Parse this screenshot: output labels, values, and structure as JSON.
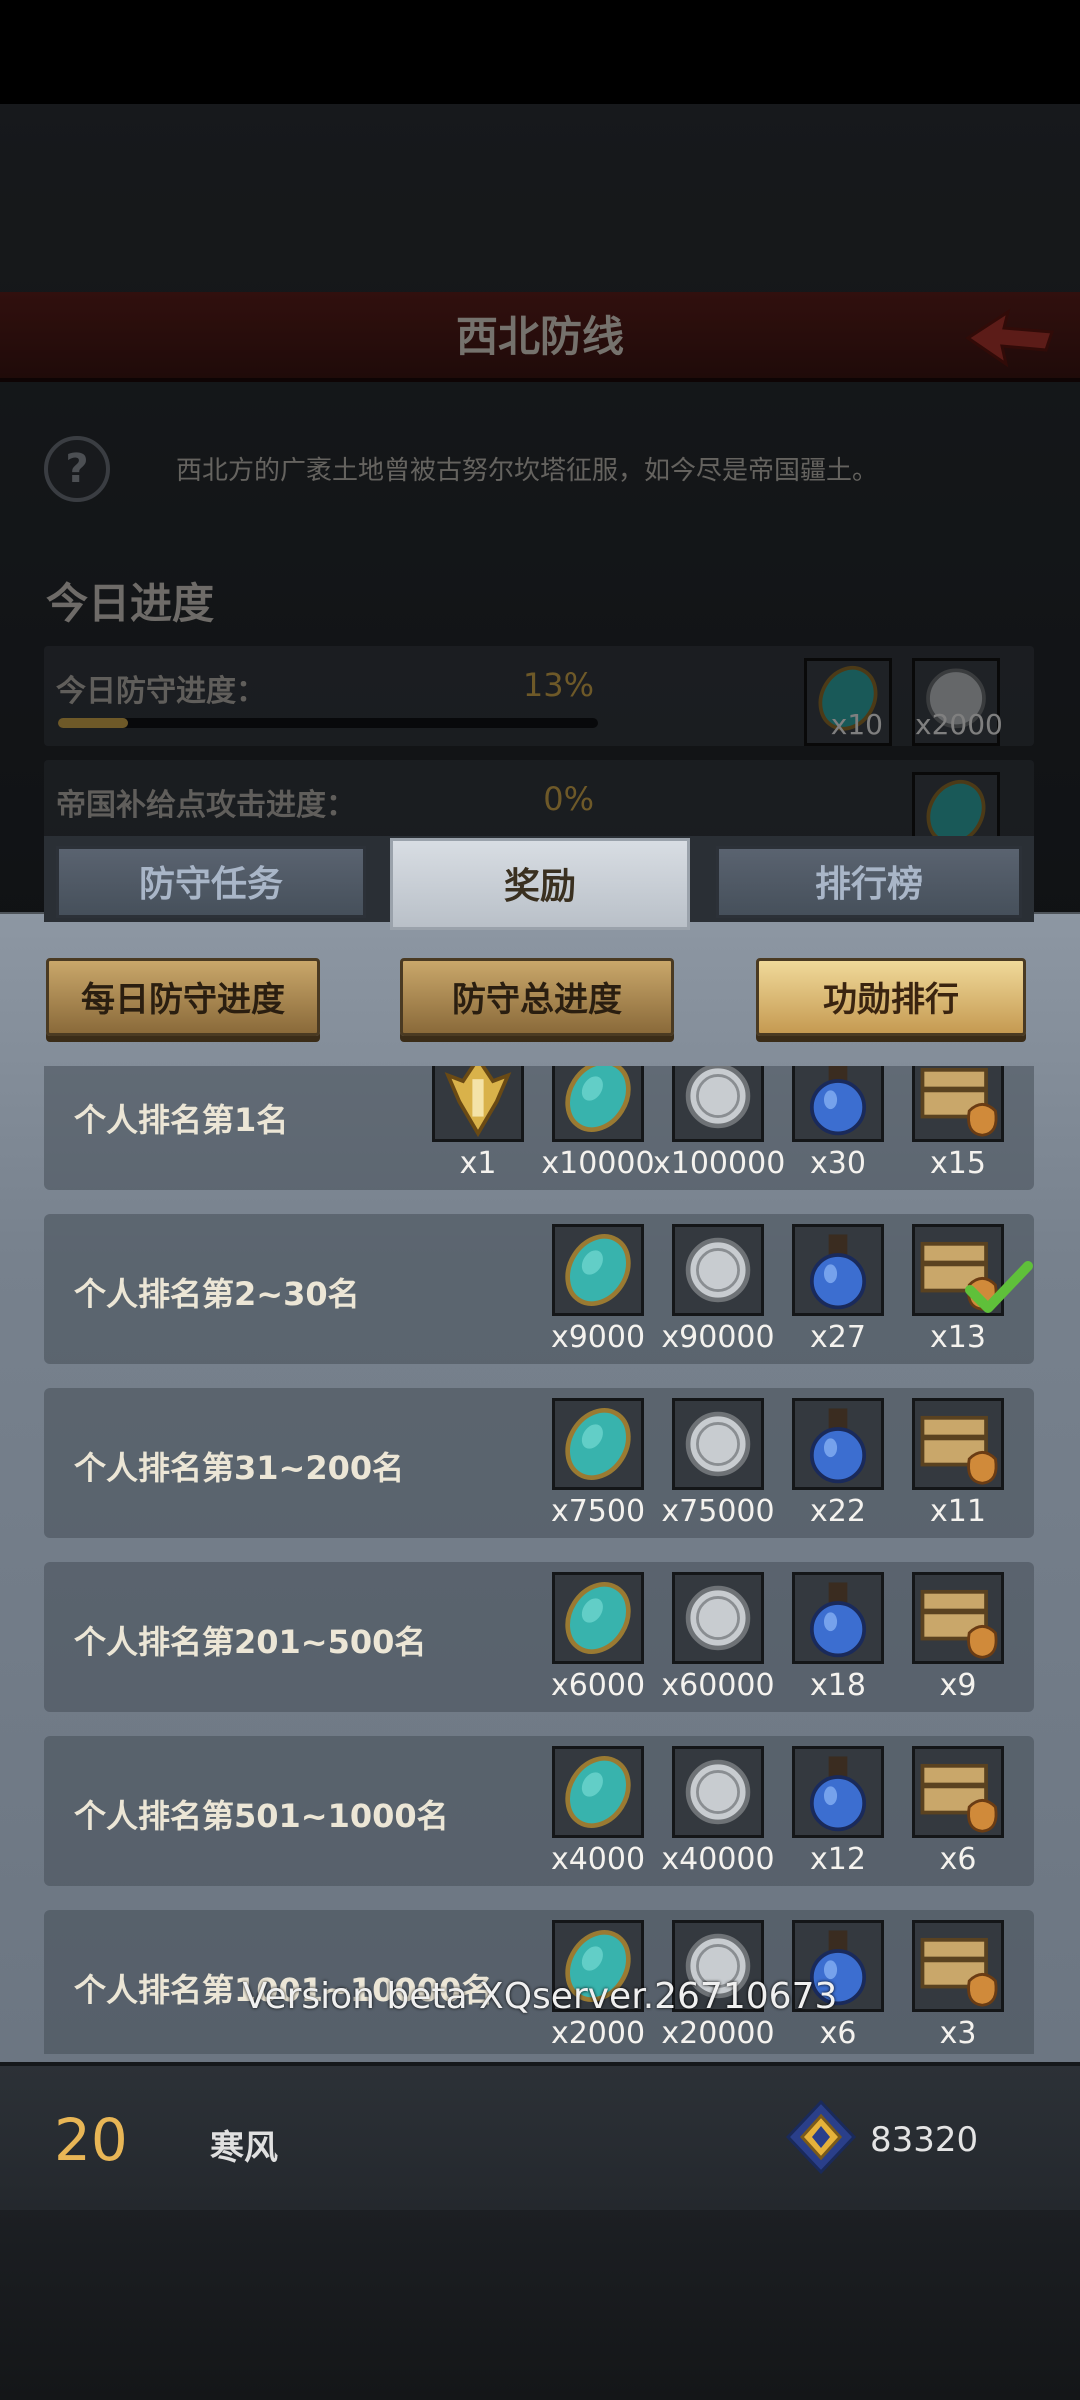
{
  "title": "西北防线",
  "description": "西北方的广袤土地曾被古努尔坎塔征服，如今尽是帝国疆土。",
  "today_section": "今日进度",
  "progress": [
    {
      "label": "今日防守进度：",
      "value": "13%",
      "fraction": 0.13,
      "rewards": [
        {
          "icon": "gem-icon",
          "count": "x10"
        },
        {
          "icon": "silver-coin-icon",
          "count": "x2000"
        }
      ]
    },
    {
      "label": "帝国补给点攻击进度：",
      "value": "0%",
      "fraction": 0,
      "rewards": [
        {
          "icon": "gem-icon",
          "count": ""
        }
      ]
    }
  ],
  "tabs": [
    {
      "label": "防守任务",
      "active": false
    },
    {
      "label": "奖励",
      "active": true
    },
    {
      "label": "排行榜",
      "active": false
    }
  ],
  "sub_tabs": [
    {
      "label": "每日防守进度",
      "active": false
    },
    {
      "label": "防守总进度",
      "active": false
    },
    {
      "label": "功勋排行",
      "active": true
    }
  ],
  "rows": [
    {
      "label": "个人排名第1名",
      "rewards": [
        {
          "icon": "emblem-icon",
          "count": "x1"
        },
        {
          "icon": "gem-icon",
          "count": "x10000"
        },
        {
          "icon": "silver-coin-icon",
          "count": "x100000"
        },
        {
          "icon": "potion-icon",
          "count": "x30"
        },
        {
          "icon": "chest-icon",
          "count": "x15"
        }
      ]
    },
    {
      "label": "个人排名第2~30名",
      "claimed": true,
      "rewards": [
        {
          "icon": "gem-icon",
          "count": "x9000"
        },
        {
          "icon": "silver-coin-icon",
          "count": "x90000"
        },
        {
          "icon": "potion-icon",
          "count": "x27"
        },
        {
          "icon": "chest-icon",
          "count": "x13"
        }
      ]
    },
    {
      "label": "个人排名第31~200名",
      "rewards": [
        {
          "icon": "gem-icon",
          "count": "x7500"
        },
        {
          "icon": "silver-coin-icon",
          "count": "x75000"
        },
        {
          "icon": "potion-icon",
          "count": "x22"
        },
        {
          "icon": "chest-icon",
          "count": "x11"
        }
      ]
    },
    {
      "label": "个人排名第201~500名",
      "rewards": [
        {
          "icon": "gem-icon",
          "count": "x6000"
        },
        {
          "icon": "silver-coin-icon",
          "count": "x60000"
        },
        {
          "icon": "potion-icon",
          "count": "x18"
        },
        {
          "icon": "chest-icon",
          "count": "x9"
        }
      ]
    },
    {
      "label": "个人排名第501~1000名",
      "rewards": [
        {
          "icon": "gem-icon",
          "count": "x4000"
        },
        {
          "icon": "silver-coin-icon",
          "count": "x40000"
        },
        {
          "icon": "potion-icon",
          "count": "x12"
        },
        {
          "icon": "chest-icon",
          "count": "x6"
        }
      ]
    },
    {
      "label": "个人排名第1001~10000名",
      "rewards": [
        {
          "icon": "gem-icon",
          "count": "x2000"
        },
        {
          "icon": "silver-coin-icon",
          "count": "x20000"
        },
        {
          "icon": "potion-icon",
          "count": "x6"
        },
        {
          "icon": "chest-icon",
          "count": "x3"
        }
      ]
    }
  ],
  "version": "Version beta XQserver.26710673",
  "footer": {
    "rank": "20",
    "name": "寒风",
    "merit": "83320"
  },
  "colors": {
    "accent_gold": "#c9a24a",
    "title_red": "#5a1e1a",
    "panel": "#7a848f"
  }
}
